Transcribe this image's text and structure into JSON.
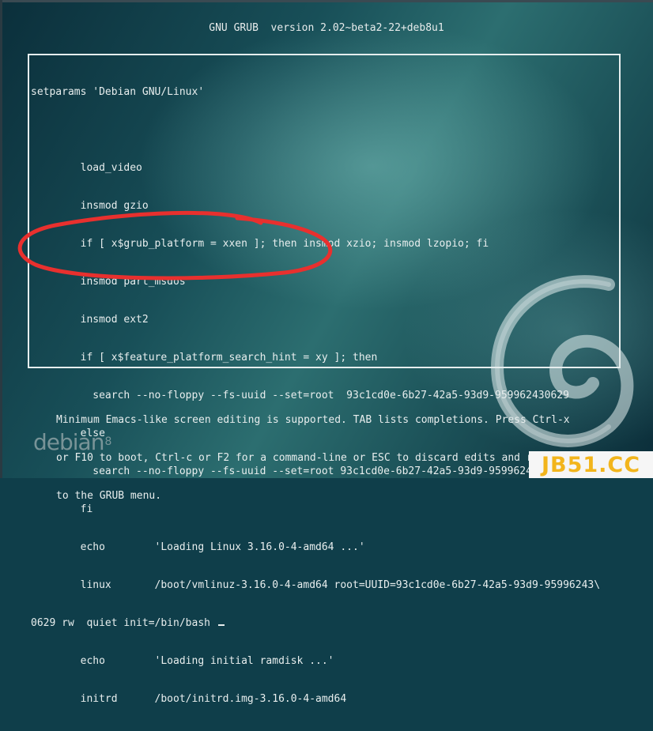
{
  "header": {
    "title": "GNU GRUB  version 2.02~beta2-22+deb8u1"
  },
  "editor": {
    "lines": [
      "setparams 'Debian GNU/Linux'",
      "",
      "        load_video",
      "        insmod gzio",
      "        if [ x$grub_platform = xxen ]; then insmod xzio; insmod lzopio; fi",
      "        insmod part_msdos",
      "        insmod ext2",
      "        if [ x$feature_platform_search_hint = xy ]; then",
      "          search --no-floppy --fs-uuid --set=root  93c1cd0e-6b27-42a5-93d9-959962430629",
      "        else",
      "          search --no-floppy --fs-uuid --set=root 93c1cd0e-6b27-42a5-93d9-959962430629",
      "        fi",
      "        echo        'Loading Linux 3.16.0-4-amd64 ...'",
      "        linux       /boot/vmlinuz-3.16.0-4-amd64 root=UUID=93c1cd0e-6b27-42a5-93d9-95996243\\",
      "0629 rw  quiet init=/bin/bash ",
      "        echo        'Loading initial ramdisk ...'",
      "        initrd      /boot/initrd.img-3.16.0-4-amd64"
    ]
  },
  "help": {
    "lines": [
      "Minimum Emacs-like screen editing is supported. TAB lists completions. Press Ctrl-x",
      "or F10 to boot, Ctrl-c or F2 for a command-line or ESC to discard edits and return",
      "to the GRUB menu."
    ]
  },
  "branding": {
    "logo_text": "debian",
    "logo_version": "8"
  },
  "watermark": {
    "text": "JB51.CC"
  },
  "annotation": {
    "color": "#e8302e",
    "icon": "red-ellipse-highlight"
  }
}
